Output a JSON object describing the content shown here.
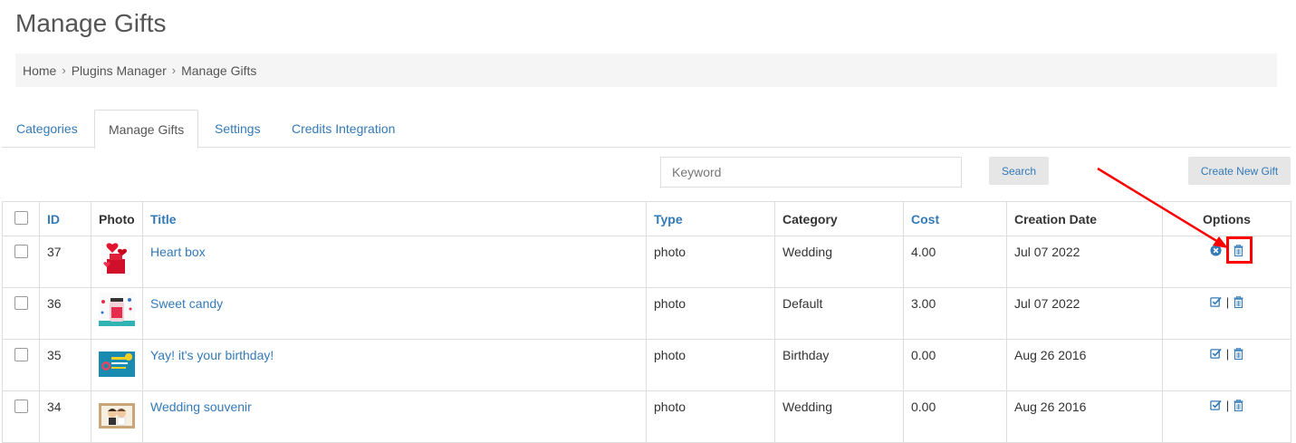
{
  "page": {
    "title": "Manage Gifts"
  },
  "breadcrumb": {
    "items": [
      "Home",
      "Plugins Manager",
      "Manage Gifts"
    ]
  },
  "tabs": [
    {
      "label": "Categories",
      "active": false
    },
    {
      "label": "Manage Gifts",
      "active": true
    },
    {
      "label": "Settings",
      "active": false
    },
    {
      "label": "Credits Integration",
      "active": false
    }
  ],
  "search": {
    "placeholder": "Keyword",
    "value": "",
    "button_label": "Search"
  },
  "create_button_label": "Create New Gift",
  "table": {
    "headers": {
      "id": "ID",
      "photo": "Photo",
      "title": "Title",
      "type": "Type",
      "category": "Category",
      "cost": "Cost",
      "date": "Creation Date",
      "options": "Options"
    },
    "rows": [
      {
        "id": "37",
        "title": "Heart box",
        "type": "photo",
        "category": "Wedding",
        "cost": "4.00",
        "date": "Jul 07 2022",
        "status_icon": "circle-x-icon"
      },
      {
        "id": "36",
        "title": "Sweet candy",
        "type": "photo",
        "category": "Default",
        "cost": "3.00",
        "date": "Jul 07 2022",
        "status_icon": "checkbox-edit-icon"
      },
      {
        "id": "35",
        "title": "Yay! it's your birthday!",
        "type": "photo",
        "category": "Birthday",
        "cost": "0.00",
        "date": "Aug 26 2016",
        "status_icon": "checkbox-edit-icon"
      },
      {
        "id": "34",
        "title": "Wedding souvenir",
        "type": "photo",
        "category": "Wedding",
        "cost": "0.00",
        "date": "Aug 26 2016",
        "status_icon": "checkbox-edit-icon"
      }
    ],
    "option_divider": "|"
  },
  "colors": {
    "link": "#337ab7",
    "annotation": "#ff0000",
    "breadcrumb_bg": "#f5f5f5"
  }
}
